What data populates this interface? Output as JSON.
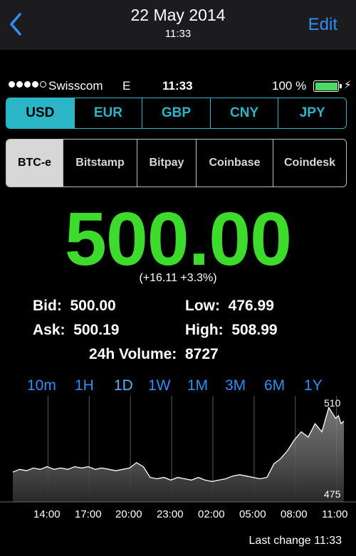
{
  "nav": {
    "back_icon": "chevron-left-icon",
    "title": "22 May 2014",
    "subtitle": "11:33",
    "edit_label": "Edit",
    "accent_color": "#2f8ff5"
  },
  "status_bar": {
    "signal_dots_filled": 4,
    "signal_dots_total": 5,
    "carrier": "Swisscom",
    "network": "E",
    "time": "11:33",
    "battery_percent": "100 %",
    "battery_level": 1.0,
    "charging_icon": "bolt-icon"
  },
  "currencies": {
    "items": [
      "USD",
      "EUR",
      "GBP",
      "CNY",
      "JPY"
    ],
    "selected": "USD",
    "color": "#2ab6c6"
  },
  "exchanges": {
    "items": [
      "BTC-e",
      "Bitstamp",
      "Bitpay",
      "Coinbase",
      "Coindesk"
    ],
    "selected": "BTC-e"
  },
  "quote": {
    "price": "500.00",
    "change": "(+16.11 +3.3%)",
    "price_color": "#3ddc2c",
    "bid_label": "Bid:",
    "bid_value": "500.00",
    "ask_label": "Ask:",
    "ask_value": "500.19",
    "low_label": "Low:",
    "low_value": "476.99",
    "high_label": "High:",
    "high_value": "508.99",
    "volume_label": "24h Volume:",
    "volume_value": "8727"
  },
  "ranges": {
    "items": [
      "10m",
      "1H",
      "1D",
      "1W",
      "1M",
      "3M",
      "6M",
      "1Y"
    ],
    "selected": "1D"
  },
  "chart_data": {
    "type": "area",
    "x_tick_labels": [
      "14:00",
      "17:00",
      "20:00",
      "23:00",
      "02:00",
      "05:00",
      "08:00",
      "11:00"
    ],
    "ylim": [
      475,
      510
    ],
    "y_tick_labels": [
      "510",
      "475"
    ],
    "grid": true,
    "x_hours": [
      11.5,
      12,
      12.5,
      13,
      13.5,
      14,
      14.5,
      15,
      15.5,
      16,
      16.5,
      17,
      17.5,
      18,
      18.5,
      19,
      19.5,
      20,
      20.5,
      21,
      21.5,
      22,
      22.5,
      23,
      23.5,
      24,
      24.5,
      25,
      25.5,
      26,
      26.5,
      27,
      27.5,
      28,
      28.5,
      29,
      29.5,
      30,
      30.5,
      31,
      31.5,
      32,
      32.5,
      33,
      33.5,
      34,
      34.5,
      35,
      35.2,
      35.4,
      35.6
    ],
    "values": [
      484,
      485,
      484.5,
      485.5,
      485,
      486,
      485,
      485.5,
      485,
      486,
      485.5,
      486,
      485,
      485.5,
      485,
      484.5,
      485,
      485.5,
      487.5,
      486,
      482,
      481.5,
      482,
      481,
      482,
      481.5,
      481,
      482,
      481,
      480.5,
      481,
      481.5,
      482.5,
      483,
      482.5,
      482,
      481.5,
      482,
      487,
      489,
      492,
      496,
      499,
      497,
      502,
      499,
      508,
      504,
      505,
      502,
      503
    ]
  },
  "footer": {
    "last_change": "Last change 11:33"
  }
}
